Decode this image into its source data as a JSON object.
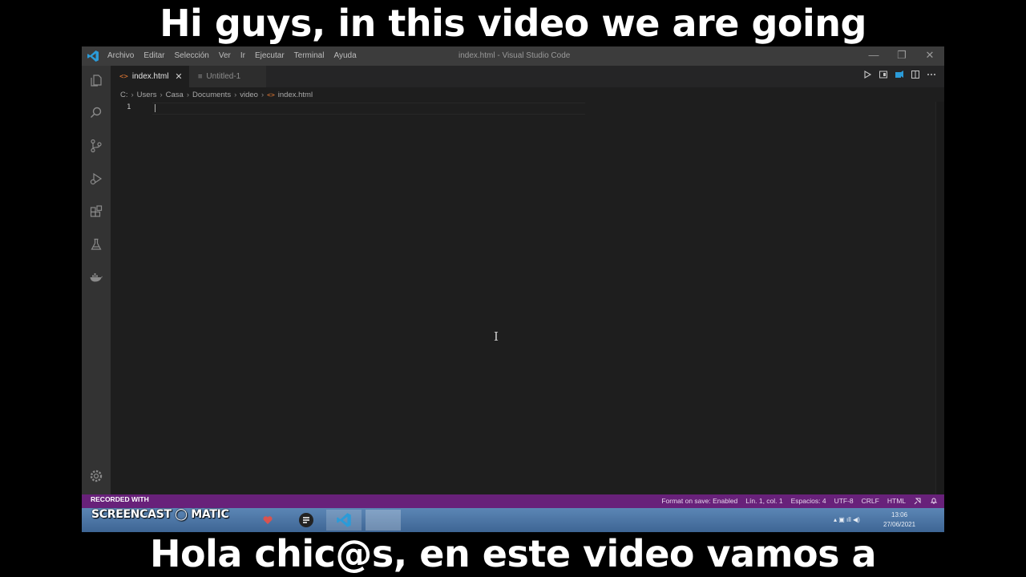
{
  "captions": {
    "top": "Hi guys, in this video we are going",
    "bottom": "Hola chic@s, en este video vamos a"
  },
  "window": {
    "menu": [
      "Archivo",
      "Editar",
      "Selección",
      "Ver",
      "Ir",
      "Ejecutar",
      "Terminal",
      "Ayuda"
    ],
    "title": "index.html - Visual Studio Code",
    "controls": {
      "minimize": "—",
      "restore": "❐",
      "close": "✕"
    }
  },
  "tabs": [
    {
      "label": "index.html",
      "icon": "html-file-icon",
      "active": true,
      "close": "✕"
    },
    {
      "label": "Untitled-1",
      "icon": "text-file-icon",
      "active": false
    }
  ],
  "breadcrumb": [
    "C:",
    "Users",
    "Casa",
    "Documents",
    "video",
    "index.html"
  ],
  "editor": {
    "line_number": "1"
  },
  "statusbar": {
    "recorded": "RECORDED WITH",
    "items": [
      "Format on save: Enabled",
      "Lín. 1, col. 1",
      "Espacios: 4",
      "UTF-8",
      "CRLF",
      "HTML"
    ]
  },
  "taskbar": {
    "brand": "SCREENCAST ◯ MATIC",
    "time": "13:06",
    "date": "27/06/2021"
  },
  "colors": {
    "status_bar": "#68217a",
    "editor_bg": "#1e1e1e",
    "activity_bar": "#333333",
    "html_icon": "#e37933",
    "vscode_blue": "#2b9bd8"
  }
}
